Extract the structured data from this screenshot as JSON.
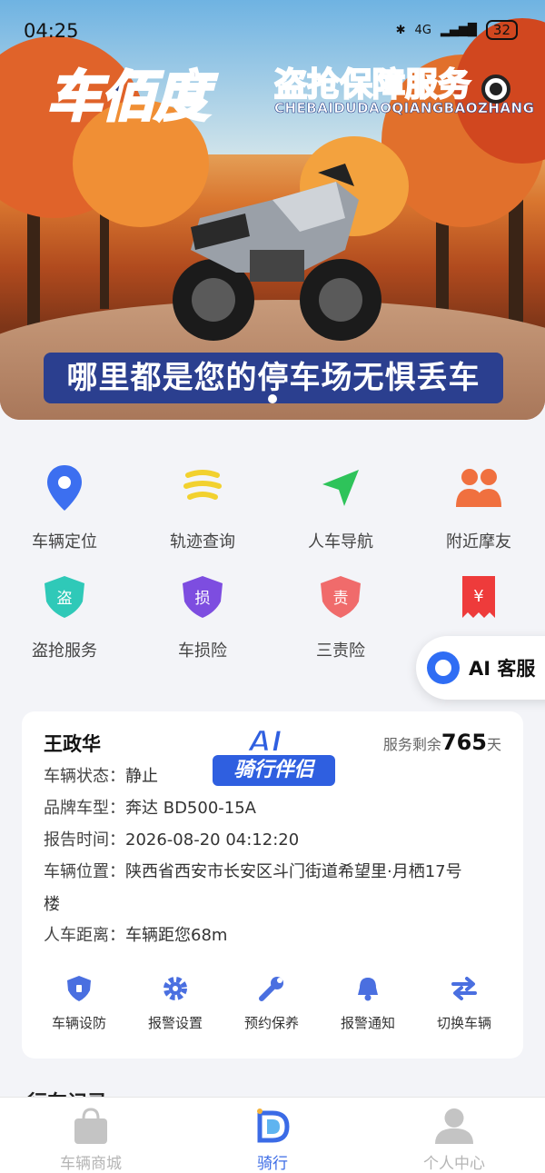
{
  "status_bar": {
    "time": "04:25",
    "battery": "32",
    "network": "4G"
  },
  "banner": {
    "brand": "车佰度",
    "brand_service": "盗抢保障服务",
    "brand_pinyin": "CHEBAIDUDAOQIANGBAOZHANG",
    "slogan": "哪里都是您的停车场无惧丢车"
  },
  "quick_actions": [
    {
      "label": "车辆定位",
      "icon": "location-pin-icon",
      "color": "#3c6ff0"
    },
    {
      "label": "轨迹查询",
      "icon": "track-icon",
      "color": "#f2d12f"
    },
    {
      "label": "人车导航",
      "icon": "navigation-arrow-icon",
      "color": "#2ec35a"
    },
    {
      "label": "附近摩友",
      "icon": "people-icon",
      "color": "#f0703f"
    },
    {
      "label": "盗抢服务",
      "icon": "theft-shield-icon",
      "color": "#2fc9b8",
      "glyph": "盗"
    },
    {
      "label": "车损险",
      "icon": "damage-shield-icon",
      "color": "#7d4de0",
      "glyph": "损"
    },
    {
      "label": "三责险",
      "icon": "liability-shield-icon",
      "color": "#f06b6b",
      "glyph": "责"
    },
    {
      "label": "",
      "icon": "yuan-receipt-icon",
      "color": "#ee3b3b",
      "glyph": "¥"
    }
  ],
  "ai_service": {
    "label": "AI 客服"
  },
  "vehicle": {
    "owner": "王政华",
    "remain_prefix": "服务剩余",
    "remain_days": "765",
    "remain_unit": "天",
    "ai_badge_top": "AI",
    "ai_badge_bottom": "骑行伴侣",
    "status_key": "车辆状态：",
    "status_val": "静止",
    "model_key": "品牌车型：",
    "model_val": "奔达 BD500-15A",
    "report_key": "报告时间：",
    "report_val": "2026-08-20 04:12:20",
    "location_key": "车辆位置：",
    "location_val_1": "陕西省西安市长安区斗门街道希望里·月栖17号",
    "location_val_2": "楼",
    "distance_key": "人车距离：",
    "distance_val": "车辆距您68m"
  },
  "vehicle_actions": [
    {
      "label": "车辆设防",
      "icon": "lock-shield-icon"
    },
    {
      "label": "报警设置",
      "icon": "gear-icon"
    },
    {
      "label": "预约保养",
      "icon": "wrench-icon"
    },
    {
      "label": "报警通知",
      "icon": "bell-icon"
    },
    {
      "label": "切换车辆",
      "icon": "swap-icon"
    }
  ],
  "section_title": "行车记录",
  "bottom_nav": [
    {
      "label": "车辆商城",
      "icon": "shop-bag-icon",
      "active": false
    },
    {
      "label": "骑行",
      "icon": "ride-logo-icon",
      "active": true
    },
    {
      "label": "个人中心",
      "icon": "person-icon",
      "active": false
    }
  ],
  "colors": {
    "accent": "#3b6be6",
    "banner_blue": "#2b3f8f"
  }
}
